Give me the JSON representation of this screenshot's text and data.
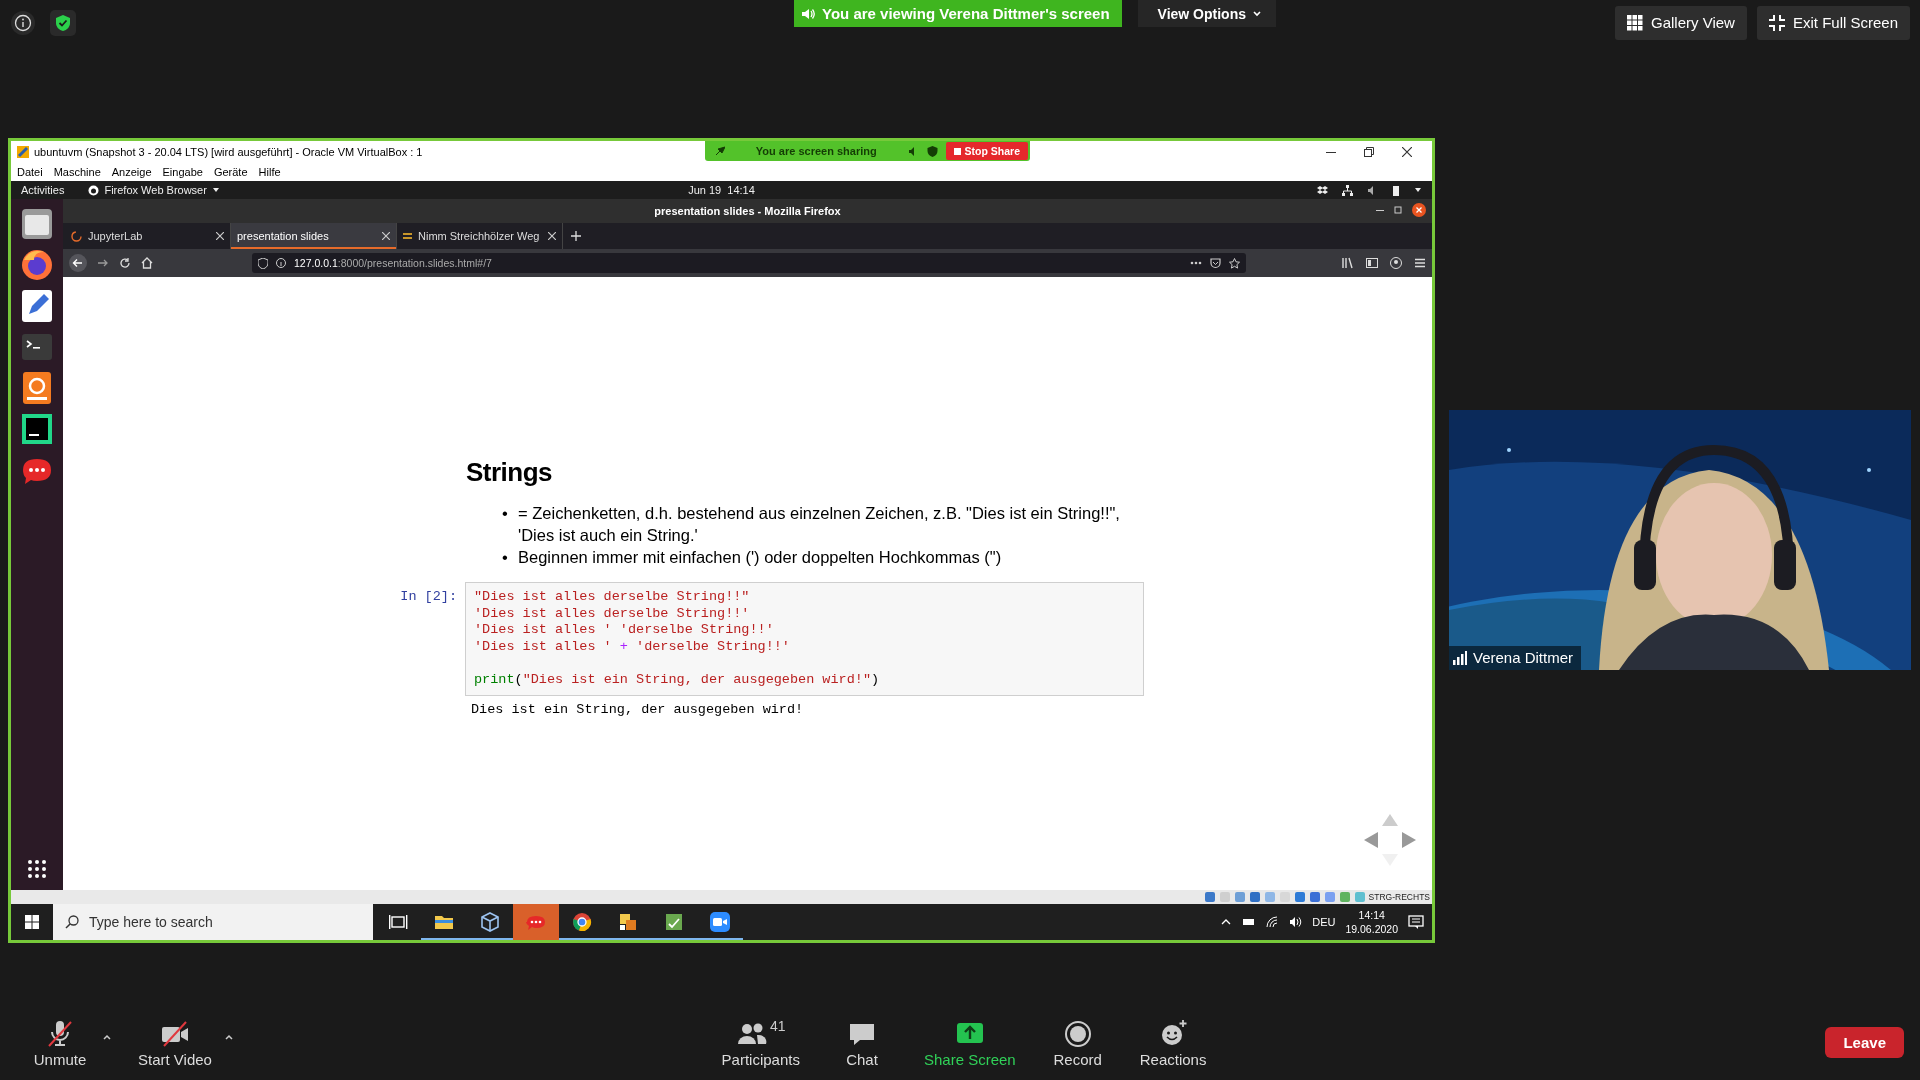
{
  "zoom_top": {
    "banner": "You are viewing Verena Dittmer's screen",
    "view_options": "View Options",
    "buttons": [
      {
        "label": "Gallery View",
        "kind": "gallery"
      },
      {
        "label": "Exit Full Screen",
        "kind": "exit"
      }
    ]
  },
  "vm_window": {
    "title": "ubuntuvm (Snapshot 3 - 20.04 LTS) [wird ausgeführt] - Oracle VM VirtualBox : 1",
    "sharing_bar": {
      "text": "You are screen sharing",
      "stop": "Stop Share"
    },
    "menu": [
      "Datei",
      "Maschine",
      "Anzeige",
      "Eingabe",
      "Geräte",
      "Hilfe"
    ],
    "status_text": "STRG-RECHTS"
  },
  "ubuntu_bar": {
    "activities": "Activities",
    "app_menu": "Firefox Web Browser",
    "clock": "Jun 19  14:14"
  },
  "dock": [
    {
      "kind": "files"
    },
    {
      "kind": "firefox"
    },
    {
      "kind": "editor"
    },
    {
      "kind": "terminal"
    },
    {
      "kind": "pdf"
    },
    {
      "kind": "ide"
    },
    {
      "kind": "chat"
    }
  ],
  "firefox": {
    "title": "presentation slides - Mozilla Firefox",
    "tabs": [
      {
        "label": "JupyterLab",
        "selected": false
      },
      {
        "label": "presentation slides",
        "selected": true
      },
      {
        "label": "Nimm Streichhölzer Weg",
        "selected": false
      }
    ],
    "url": {
      "host": "127.0.0.1",
      "path": ":8000/presentation.slides.html#/7"
    }
  },
  "slide": {
    "title": "Strings",
    "marker": "•",
    "bullets": [
      "= Zeichenketten, d.h. bestehend aus einzelnen Zeichen, z.B. \"Dies ist ein String!!\", 'Dies ist auch ein String.'",
      "Beginnen immer mit einfachen (') oder doppelten Hochkommas (\")"
    ],
    "prompt": "In [2]:",
    "code": [
      {
        "gap_before": false,
        "tokens": [
          {
            "kind": "string",
            "text": "\"Dies ist alles derselbe String!!\""
          }
        ]
      },
      {
        "gap_before": false,
        "tokens": [
          {
            "kind": "string",
            "text": "'Dies ist alles derselbe String!!'"
          }
        ]
      },
      {
        "gap_before": false,
        "tokens": [
          {
            "kind": "string",
            "text": "'Dies ist alles ' 'derselbe String!!'"
          }
        ]
      },
      {
        "gap_before": false,
        "tokens": [
          {
            "kind": "string",
            "text": "'Dies ist alles '"
          },
          {
            "kind": "op",
            "text": " + "
          },
          {
            "kind": "string",
            "text": "'derselbe String!!'"
          }
        ]
      },
      {
        "gap_before": true,
        "tokens": [
          {
            "kind": "builtin",
            "text": "print"
          },
          {
            "kind": "plain",
            "text": "("
          },
          {
            "kind": "string",
            "text": "\"Dies ist ein String, der ausgegeben wird!\""
          },
          {
            "kind": "plain",
            "text": ")"
          }
        ]
      }
    ],
    "output": "Dies ist ein String, der ausgegeben wird!"
  },
  "taskbar": {
    "search_placeholder": "Type here to search",
    "apps": [
      {
        "kind": "taskview",
        "running": false
      },
      {
        "kind": "explorer",
        "running": true
      },
      {
        "kind": "virtualbox",
        "running": true
      },
      {
        "kind": "chat",
        "running": false
      },
      {
        "kind": "chrome",
        "running": true
      },
      {
        "kind": "app",
        "running": true
      },
      {
        "kind": "sheet",
        "running": true
      },
      {
        "kind": "zoom",
        "running": true
      }
    ],
    "language": "DEU",
    "time": "14:14",
    "date": "19.06.2020"
  },
  "video_tile": {
    "name": "Verena Dittmer"
  },
  "zoom_toolbar": {
    "left": [
      {
        "label": "Unmute",
        "kind": "mic",
        "muted": true
      },
      {
        "label": "Start Video",
        "kind": "video",
        "muted": true
      }
    ],
    "center": [
      {
        "label": "Participants",
        "kind": "participants",
        "count": "41"
      },
      {
        "label": "Chat",
        "kind": "chat"
      },
      {
        "label": "Share Screen",
        "kind": "share"
      },
      {
        "label": "Record",
        "kind": "record"
      },
      {
        "label": "Reactions",
        "kind": "reactions"
      }
    ],
    "leave": "Leave"
  }
}
